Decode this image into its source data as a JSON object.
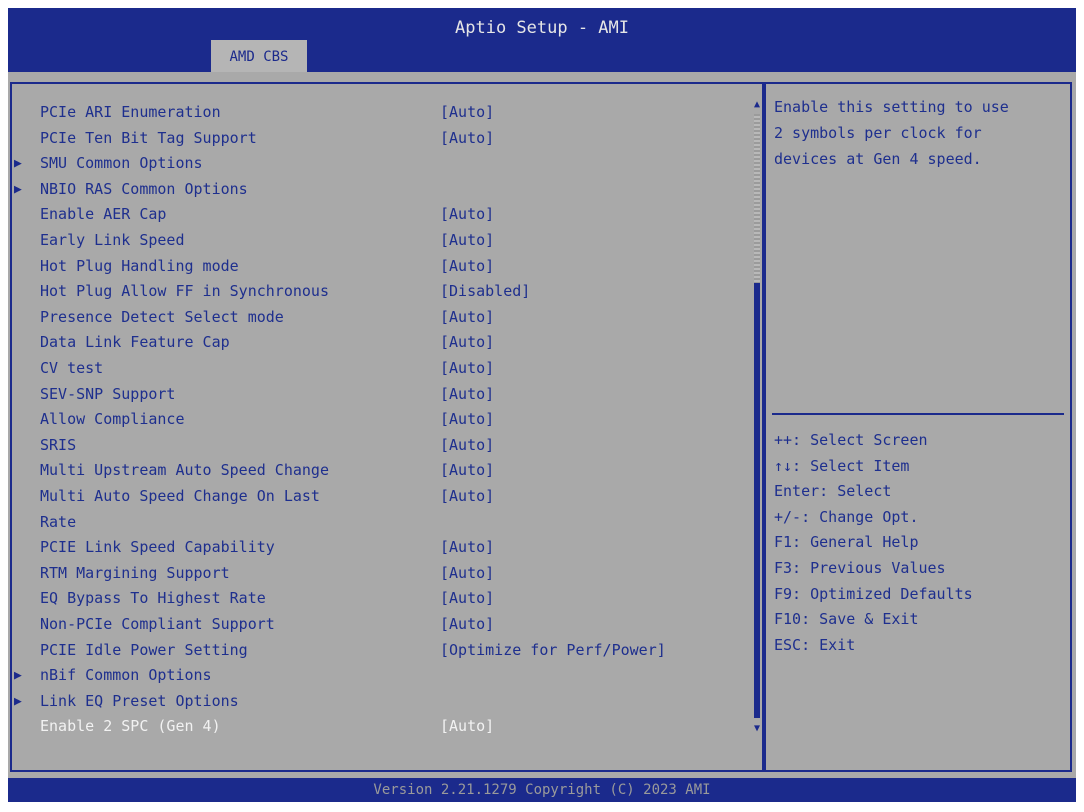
{
  "header": {
    "title": "Aptio Setup - AMI",
    "tab_label": "AMD CBS"
  },
  "options": [
    {
      "label": "PCIe ARI Enumeration",
      "value": "[Auto]",
      "submenu": false,
      "selected": false
    },
    {
      "label": "PCIe Ten Bit Tag Support",
      "value": "[Auto]",
      "submenu": false,
      "selected": false
    },
    {
      "label": "SMU Common Options",
      "value": "",
      "submenu": true,
      "selected": false
    },
    {
      "label": "NBIO RAS Common Options",
      "value": "",
      "submenu": true,
      "selected": false
    },
    {
      "label": "Enable AER Cap",
      "value": "[Auto]",
      "submenu": false,
      "selected": false
    },
    {
      "label": "Early Link Speed",
      "value": "[Auto]",
      "submenu": false,
      "selected": false
    },
    {
      "label": "Hot Plug Handling mode",
      "value": "[Auto]",
      "submenu": false,
      "selected": false
    },
    {
      "label": "Hot Plug Allow FF in Synchronous",
      "value": "[Disabled]",
      "submenu": false,
      "selected": false
    },
    {
      "label": "Presence Detect Select mode",
      "value": "[Auto]",
      "submenu": false,
      "selected": false
    },
    {
      "label": "Data Link Feature Cap",
      "value": "[Auto]",
      "submenu": false,
      "selected": false
    },
    {
      "label": "CV test",
      "value": "[Auto]",
      "submenu": false,
      "selected": false
    },
    {
      "label": "SEV-SNP Support",
      "value": "[Auto]",
      "submenu": false,
      "selected": false
    },
    {
      "label": "Allow Compliance",
      "value": "[Auto]",
      "submenu": false,
      "selected": false
    },
    {
      "label": "SRIS",
      "value": "[Auto]",
      "submenu": false,
      "selected": false
    },
    {
      "label": "Multi Upstream Auto Speed Change",
      "value": "[Auto]",
      "submenu": false,
      "selected": false
    },
    {
      "label": "Multi Auto Speed Change On Last",
      "value": "[Auto]",
      "submenu": false,
      "selected": false
    },
    {
      "label": "Rate",
      "value": "",
      "submenu": false,
      "selected": false
    },
    {
      "label": "PCIE Link Speed Capability",
      "value": "[Auto]",
      "submenu": false,
      "selected": false
    },
    {
      "label": "RTM Margining Support",
      "value": "[Auto]",
      "submenu": false,
      "selected": false
    },
    {
      "label": "EQ Bypass To Highest Rate",
      "value": "[Auto]",
      "submenu": false,
      "selected": false
    },
    {
      "label": "Non-PCIe Compliant Support",
      "value": "[Auto]",
      "submenu": false,
      "selected": false
    },
    {
      "label": "PCIE Idle Power Setting",
      "value": "[Optimize for Perf/Power]",
      "submenu": false,
      "selected": false
    },
    {
      "label": "nBif Common Options",
      "value": "",
      "submenu": true,
      "selected": false
    },
    {
      "label": "Link EQ Preset Options",
      "value": "",
      "submenu": true,
      "selected": false
    },
    {
      "label": "Enable 2 SPC (Gen 4)",
      "value": "[Auto]",
      "submenu": false,
      "selected": true
    }
  ],
  "scrollbar": {
    "thumb_start_fraction": 0.28,
    "thumb_end_fraction": 1.0
  },
  "help": {
    "lines": [
      "Enable this setting to use",
      "2 symbols per clock for",
      "devices at Gen 4 speed."
    ]
  },
  "keys": [
    "++: Select Screen",
    "↑↓: Select Item",
    "Enter: Select",
    "+/-: Change Opt.",
    "F1: General Help",
    "F3: Previous Values",
    "F9: Optimized Defaults",
    "F10: Save & Exit",
    "ESC: Exit"
  ],
  "footer": {
    "version": "Version 2.21.1279 Copyright (C) 2023 AMI"
  },
  "colors": {
    "bar_blue": "#1b2a8c",
    "panel_gray": "#a9a9a9",
    "text_blue": "#1e2f8e",
    "selected_text": "#f2f2f2",
    "footer_text": "#9a9a9a"
  }
}
